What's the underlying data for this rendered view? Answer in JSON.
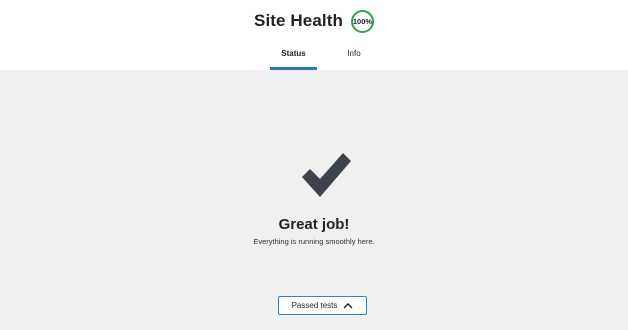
{
  "header": {
    "title": "Site Health",
    "score": "100%",
    "score_color": "#36a04a"
  },
  "tabs": [
    {
      "label": "Status",
      "active": true
    },
    {
      "label": "Info",
      "active": false
    }
  ],
  "accent_color": "#2a77b8",
  "main": {
    "icon": "checkmark-icon",
    "heading": "Great job!",
    "message": "Everything is running smoothly here.",
    "passed_tests_label": "Passed tests",
    "passed_tests_icon": "chevron-up-icon"
  }
}
